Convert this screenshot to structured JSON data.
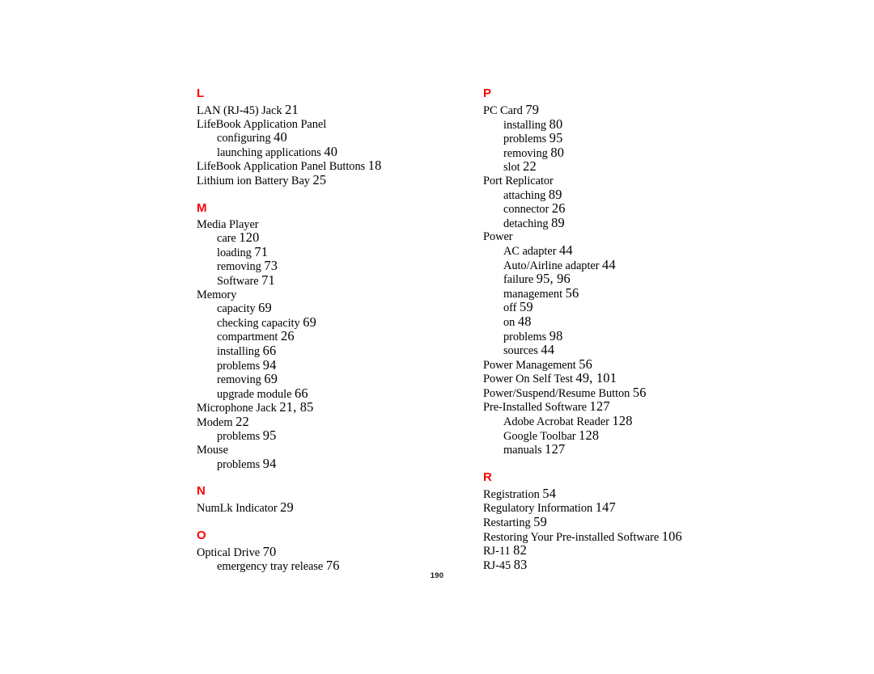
{
  "document": {
    "type": "index",
    "page_number": "190",
    "accent_color": "#ff0000",
    "text_color": "#000000",
    "background_color": "#ffffff"
  },
  "columns": [
    {
      "name": "left",
      "sections": [
        {
          "letter": "L",
          "entries": [
            {
              "term": "LAN (RJ-45) Jack",
              "pages": "21",
              "level": 0
            },
            {
              "term": "LifeBook Application Panel",
              "pages": "",
              "level": 0
            },
            {
              "term": "configuring",
              "pages": "40",
              "level": 1
            },
            {
              "term": "launching applications",
              "pages": "40",
              "level": 1
            },
            {
              "term": "LifeBook Application Panel Buttons",
              "pages": "18",
              "level": 0
            },
            {
              "term": "Lithium ion Battery Bay",
              "pages": "25",
              "level": 0
            }
          ]
        },
        {
          "letter": "M",
          "entries": [
            {
              "term": "Media Player",
              "pages": "",
              "level": 0
            },
            {
              "term": "care",
              "pages": "120",
              "level": 1
            },
            {
              "term": "loading",
              "pages": "71",
              "level": 1
            },
            {
              "term": "removing",
              "pages": "73",
              "level": 1
            },
            {
              "term": "Software",
              "pages": "71",
              "level": 1
            },
            {
              "term": "Memory",
              "pages": "",
              "level": 0
            },
            {
              "term": "capacity",
              "pages": "69",
              "level": 1
            },
            {
              "term": "checking capacity",
              "pages": "69",
              "level": 1
            },
            {
              "term": "compartment",
              "pages": "26",
              "level": 1
            },
            {
              "term": "installing",
              "pages": "66",
              "level": 1
            },
            {
              "term": "problems",
              "pages": "94",
              "level": 1
            },
            {
              "term": "removing",
              "pages": "69",
              "level": 1
            },
            {
              "term": "upgrade module",
              "pages": "66",
              "level": 1
            },
            {
              "term": "Microphone Jack",
              "pages": "21, 85",
              "level": 0
            },
            {
              "term": "Modem",
              "pages": "22",
              "level": 0
            },
            {
              "term": "problems",
              "pages": "95",
              "level": 1
            },
            {
              "term": "Mouse",
              "pages": "",
              "level": 0
            },
            {
              "term": "problems",
              "pages": "94",
              "level": 1
            }
          ]
        },
        {
          "letter": "N",
          "entries": [
            {
              "term": "NumLk Indicator",
              "pages": "29",
              "level": 0
            }
          ]
        },
        {
          "letter": "O",
          "entries": [
            {
              "term": "Optical Drive",
              "pages": "70",
              "level": 0
            },
            {
              "term": "emergency tray release",
              "pages": "76",
              "level": 1
            }
          ]
        }
      ]
    },
    {
      "name": "right",
      "sections": [
        {
          "letter": "P",
          "entries": [
            {
              "term": "PC Card",
              "pages": "79",
              "level": 0
            },
            {
              "term": "installing",
              "pages": "80",
              "level": 1
            },
            {
              "term": "problems",
              "pages": "95",
              "level": 1
            },
            {
              "term": "removing",
              "pages": "80",
              "level": 1
            },
            {
              "term": "slot",
              "pages": "22",
              "level": 1
            },
            {
              "term": "Port Replicator",
              "pages": "",
              "level": 0
            },
            {
              "term": "attaching",
              "pages": "89",
              "level": 1
            },
            {
              "term": "connector",
              "pages": "26",
              "level": 1
            },
            {
              "term": "detaching",
              "pages": "89",
              "level": 1
            },
            {
              "term": "Power",
              "pages": "",
              "level": 0
            },
            {
              "term": "AC adapter",
              "pages": "44",
              "level": 1
            },
            {
              "term": "Auto/Airline adapter",
              "pages": "44",
              "level": 1
            },
            {
              "term": "failure",
              "pages": "95, 96",
              "level": 1
            },
            {
              "term": "management",
              "pages": "56",
              "level": 1
            },
            {
              "term": "off",
              "pages": "59",
              "level": 1
            },
            {
              "term": "on",
              "pages": "48",
              "level": 1
            },
            {
              "term": "problems",
              "pages": "98",
              "level": 1
            },
            {
              "term": "sources",
              "pages": "44",
              "level": 1
            },
            {
              "term": "Power Management",
              "pages": "56",
              "level": 0
            },
            {
              "term": "Power On Self Test",
              "pages": "49, 101",
              "level": 0
            },
            {
              "term": "Power/Suspend/Resume Button",
              "pages": "56",
              "level": 0
            },
            {
              "term": "Pre-Installed Software",
              "pages": "127",
              "level": 0
            },
            {
              "term": "Adobe Acrobat Reader",
              "pages": "128",
              "level": 1
            },
            {
              "term": "Google Toolbar",
              "pages": "128",
              "level": 1
            },
            {
              "term": "manuals",
              "pages": "127",
              "level": 1
            }
          ]
        },
        {
          "letter": "R",
          "entries": [
            {
              "term": "Registration",
              "pages": "54",
              "level": 0
            },
            {
              "term": "Regulatory Information",
              "pages": "147",
              "level": 0
            },
            {
              "term": "Restarting",
              "pages": "59",
              "level": 0
            },
            {
              "term": "Restoring Your Pre-installed Software",
              "pages": "106",
              "level": 0
            },
            {
              "term": "RJ-11",
              "pages": "82",
              "level": 0
            },
            {
              "term": "RJ-45",
              "pages": "83",
              "level": 0
            }
          ]
        }
      ]
    }
  ]
}
